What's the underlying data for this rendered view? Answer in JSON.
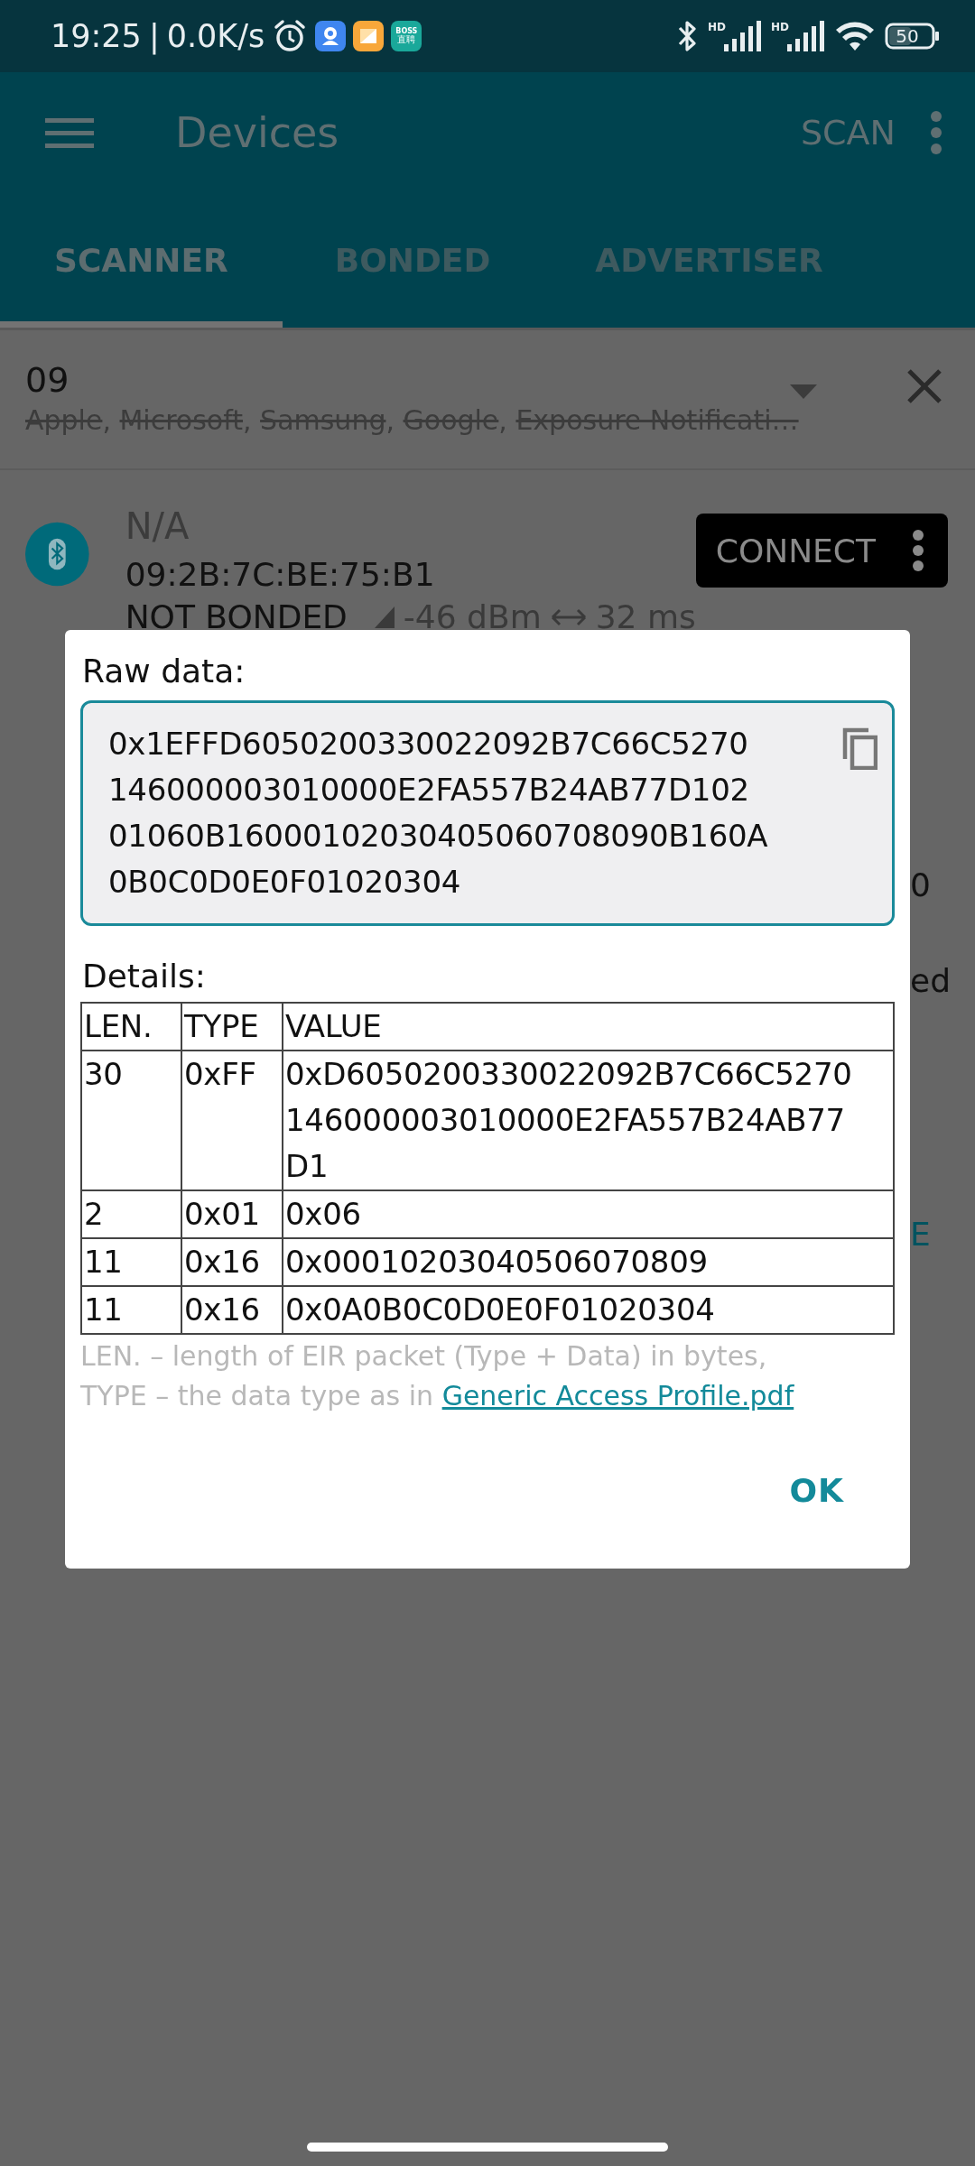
{
  "status_bar": {
    "time": "19:25",
    "separator": "|",
    "net_speed": "0.0K/s",
    "app_icons": [
      {
        "kind": "camera"
      },
      {
        "kind": "gallery"
      },
      {
        "kind": "boss",
        "lines": [
          "BOSS",
          "直聘"
        ]
      }
    ],
    "signal_labels": [
      "HD",
      "HD"
    ],
    "battery": "50"
  },
  "app_bar": {
    "title": "Devices",
    "action": "SCAN"
  },
  "tabs": [
    {
      "label": "SCANNER",
      "selected": true
    },
    {
      "label": "BONDED",
      "selected": false
    },
    {
      "label": "ADVERTISER",
      "selected": false
    }
  ],
  "filter": {
    "value": "09",
    "separator": ", ",
    "excluded": [
      {
        "name": "Apple",
        "struck": true
      },
      {
        "name": "Microsoft",
        "struck": true
      },
      {
        "name": "Samsung",
        "struck": true
      },
      {
        "name": "Google",
        "struck": true
      },
      {
        "name": "Exposure Notificati…",
        "struck": true
      }
    ]
  },
  "device": {
    "name": "N/A",
    "address": "09:2B:7C:BE:75:B1",
    "bond": "NOT BONDED",
    "rssi": "-46 dBm",
    "interval": "32 ms",
    "button": "CONNECT"
  },
  "background_fragments": [
    {
      "text": "0",
      "kind": "plain"
    },
    {
      "text": "ed",
      "kind": "plain"
    },
    {
      "text": "E",
      "kind": "link"
    }
  ],
  "dialog": {
    "raw_label": "Raw data:",
    "raw_lines": [
      "0x1EFFD6050200330022092B7C66C5270",
      "146000003010000E2FA557B24AB77D102",
      "01060B16000102030405060708090B160A",
      "0B0C0D0E0F01020304"
    ],
    "details_label": "Details:",
    "columns": [
      "LEN.",
      "TYPE",
      "VALUE"
    ],
    "rows": [
      {
        "len": "30",
        "type": "0xFF",
        "value_lines": [
          "0xD6050200330022092B7C66C5270",
          "146000003010000E2FA557B24AB77",
          "D1"
        ]
      },
      {
        "len": "2",
        "type": "0x01",
        "value_lines": [
          "0x06"
        ]
      },
      {
        "len": "11",
        "type": "0x16",
        "value_lines": [
          "0x00010203040506070809"
        ]
      },
      {
        "len": "11",
        "type": "0x16",
        "value_lines": [
          "0x0A0B0C0D0E0F01020304"
        ]
      }
    ],
    "note_lines": [
      "LEN. – length of EIR packet (Type + Data) in bytes,",
      "TYPE – the data type as in "
    ],
    "note_link": "Generic Access Profile.pdf",
    "ok": "OK"
  }
}
